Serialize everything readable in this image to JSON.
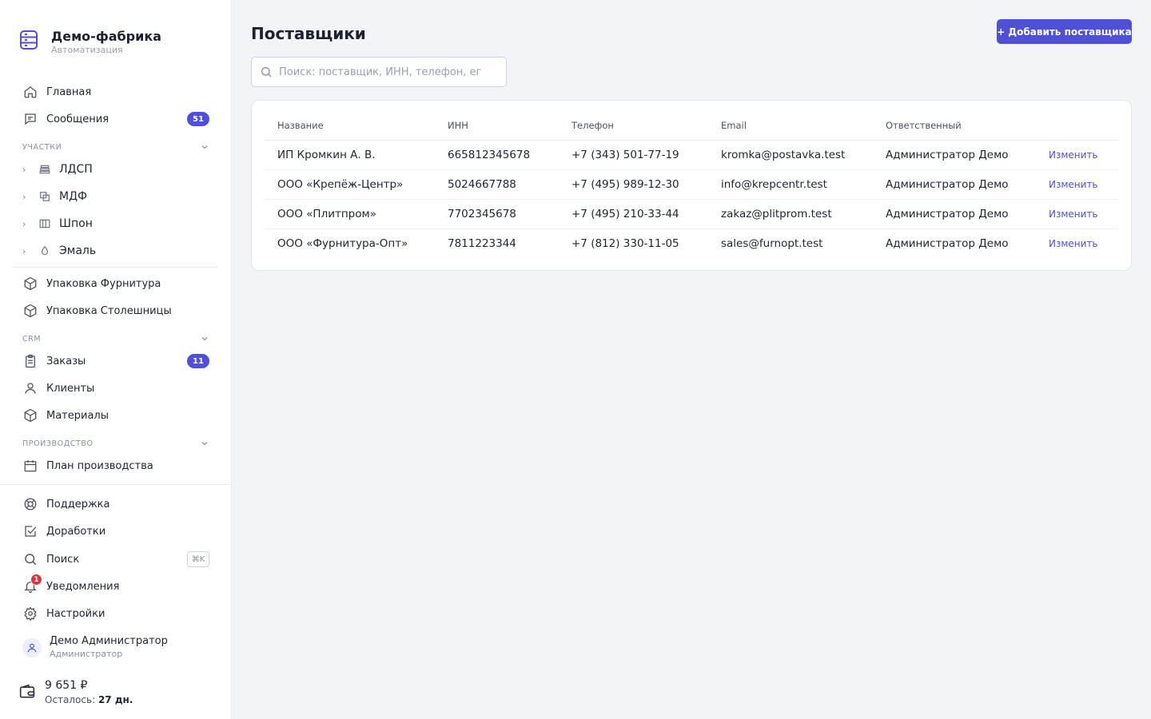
{
  "brand": {
    "title": "Демо-фабрика",
    "subtitle": "Автоматизация"
  },
  "nav": {
    "home": "Главная",
    "messages": "Сообщения",
    "messages_badge": "51",
    "section_sites": "Участки",
    "sites": [
      {
        "label": "ЛДСП",
        "icon": "layers-icon"
      },
      {
        "label": "МДФ",
        "icon": "copy-icon"
      },
      {
        "label": "Шпон",
        "icon": "columns-icon"
      },
      {
        "label": "Эмаль",
        "icon": "drop-icon"
      }
    ],
    "packing_hardware": "Упаковка Фурнитура",
    "packing_tops": "Упаковка Столешницы",
    "section_crm": "CRM",
    "orders": "Заказы",
    "orders_badge": "11",
    "clients": "Клиенты",
    "materials": "Материалы",
    "section_production": "Производство",
    "production_plan": "План производства",
    "support": "Поддержка",
    "improvements": "Доработки",
    "search": "Поиск",
    "search_shortcut": "⌘K",
    "notifications": "Уведомления",
    "notifications_count": "1",
    "settings": "Настройки"
  },
  "user": {
    "name": "Демо Администратор",
    "role": "Администратор"
  },
  "wallet": {
    "balance": "9 651 ₽",
    "remain_label": "Осталось:",
    "remain_value": "27 дн."
  },
  "page": {
    "title": "Поставщики",
    "add_button": "+ Добавить поставщика",
    "search_placeholder": "Поиск: поставщик, ИНН, телефон, ег"
  },
  "table": {
    "columns": [
      "Название",
      "ИНН",
      "Телефон",
      "Email",
      "Ответственный",
      ""
    ],
    "edit_label": "Изменить",
    "rows": [
      {
        "name": "ИП Кромкин А. В.",
        "inn": "665812345678",
        "phone": "+7 (343) 501-77-19",
        "email": "kromka@postavka.test",
        "owner": "Администратор Демо"
      },
      {
        "name": "ООО «Крепёж-Центр»",
        "inn": "5024667788",
        "phone": "+7 (495) 989-12-30",
        "email": "info@krepcentr.test",
        "owner": "Администратор Демо"
      },
      {
        "name": "ООО «Плитпром»",
        "inn": "7702345678",
        "phone": "+7 (495) 210-33-44",
        "email": "zakaz@plitprom.test",
        "owner": "Администратор Демо"
      },
      {
        "name": "ООО «Фурнитура-Опт»",
        "inn": "7811223344",
        "phone": "+7 (812) 330-11-05",
        "email": "sales@furnopt.test",
        "owner": "Администратор Демо"
      }
    ]
  },
  "colors": {
    "accent": "#4f4fd8",
    "danger": "#d9363e"
  }
}
